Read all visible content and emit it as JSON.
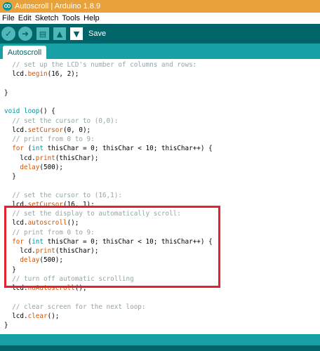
{
  "window": {
    "title": "Autoscroll | Arduino 1.8.9"
  },
  "menu": {
    "items": [
      "File",
      "Edit",
      "Sketch",
      "Tools",
      "Help"
    ]
  },
  "toolbar": {
    "verify_icon": "check-icon",
    "upload_icon": "arrow-right-icon",
    "new_icon": "new-file-icon",
    "open_icon": "arrow-up-icon",
    "save_icon": "arrow-down-icon",
    "hover_label": "Save"
  },
  "tabs": [
    {
      "label": "Autoscroll"
    }
  ],
  "editor": {
    "lines": [
      [
        {
          "t": "  // set up the LCD's number of columns and rows:",
          "c": "comment"
        }
      ],
      [
        {
          "t": "  lcd.",
          "c": "plain"
        },
        {
          "t": "begin",
          "c": "fn"
        },
        {
          "t": "(16, 2);",
          "c": "plain"
        }
      ],
      [
        {
          "t": "",
          "c": "plain"
        }
      ],
      [
        {
          "t": "}",
          "c": "plain"
        }
      ],
      [
        {
          "t": "",
          "c": "plain"
        }
      ],
      [
        {
          "t": "void",
          "c": "kw"
        },
        {
          "t": " ",
          "c": "plain"
        },
        {
          "t": "loop",
          "c": "kw"
        },
        {
          "t": "() {",
          "c": "plain"
        }
      ],
      [
        {
          "t": "  // set the cursor to (0,0):",
          "c": "comment"
        }
      ],
      [
        {
          "t": "  lcd.",
          "c": "plain"
        },
        {
          "t": "setCursor",
          "c": "fn"
        },
        {
          "t": "(0, 0);",
          "c": "plain"
        }
      ],
      [
        {
          "t": "  // print from 0 to 9:",
          "c": "comment"
        }
      ],
      [
        {
          "t": "  ",
          "c": "plain"
        },
        {
          "t": "for",
          "c": "fn"
        },
        {
          "t": " (",
          "c": "plain"
        },
        {
          "t": "int",
          "c": "kw"
        },
        {
          "t": " thisChar = 0; thisChar < 10; thisChar++) {",
          "c": "plain"
        }
      ],
      [
        {
          "t": "    lcd.",
          "c": "plain"
        },
        {
          "t": "print",
          "c": "fn"
        },
        {
          "t": "(thisChar);",
          "c": "plain"
        }
      ],
      [
        {
          "t": "    ",
          "c": "plain"
        },
        {
          "t": "delay",
          "c": "fn"
        },
        {
          "t": "(500);",
          "c": "plain"
        }
      ],
      [
        {
          "t": "  }",
          "c": "plain"
        }
      ],
      [
        {
          "t": "",
          "c": "plain"
        }
      ],
      [
        {
          "t": "  // set the cursor to (16,1):",
          "c": "comment"
        }
      ],
      [
        {
          "t": "  lcd.",
          "c": "plain"
        },
        {
          "t": "setCursor",
          "c": "fn"
        },
        {
          "t": "(16, 1);",
          "c": "plain"
        }
      ],
      [
        {
          "t": "  // set the display to automatically scroll:",
          "c": "comment"
        }
      ],
      [
        {
          "t": "  lcd.",
          "c": "plain"
        },
        {
          "t": "autoscroll",
          "c": "fn"
        },
        {
          "t": "();",
          "c": "plain"
        }
      ],
      [
        {
          "t": "  // print from 0 to 9:",
          "c": "comment"
        }
      ],
      [
        {
          "t": "  ",
          "c": "plain"
        },
        {
          "t": "for",
          "c": "fn"
        },
        {
          "t": " (",
          "c": "plain"
        },
        {
          "t": "int",
          "c": "kw"
        },
        {
          "t": " thisChar = 0; thisChar < 10; thisChar++) {",
          "c": "plain"
        }
      ],
      [
        {
          "t": "    lcd.",
          "c": "plain"
        },
        {
          "t": "print",
          "c": "fn"
        },
        {
          "t": "(thisChar);",
          "c": "plain"
        }
      ],
      [
        {
          "t": "    ",
          "c": "plain"
        },
        {
          "t": "delay",
          "c": "fn"
        },
        {
          "t": "(500);",
          "c": "plain"
        }
      ],
      [
        {
          "t": "  }",
          "c": "plain"
        }
      ],
      [
        {
          "t": "  // turn off automatic scrolling",
          "c": "comment"
        }
      ],
      [
        {
          "t": "  lcd.",
          "c": "plain"
        },
        {
          "t": "noAutoscroll",
          "c": "fn"
        },
        {
          "t": "();",
          "c": "plain"
        }
      ],
      [
        {
          "t": "",
          "c": "plain"
        }
      ],
      [
        {
          "t": "  // clear screen for the next loop:",
          "c": "comment"
        }
      ],
      [
        {
          "t": "  lcd.",
          "c": "plain"
        },
        {
          "t": "clear",
          "c": "fn"
        },
        {
          "t": "();",
          "c": "plain"
        }
      ],
      [
        {
          "t": "}",
          "c": "plain"
        }
      ]
    ]
  },
  "annotation": {
    "color": "#e0242e"
  },
  "colors": {
    "titlebar": "#e8a23b",
    "toolbar": "#006468",
    "tabstrip": "#17a1a5",
    "comment": "#95a5a6",
    "keyword": "#00979c",
    "function": "#d35400"
  }
}
